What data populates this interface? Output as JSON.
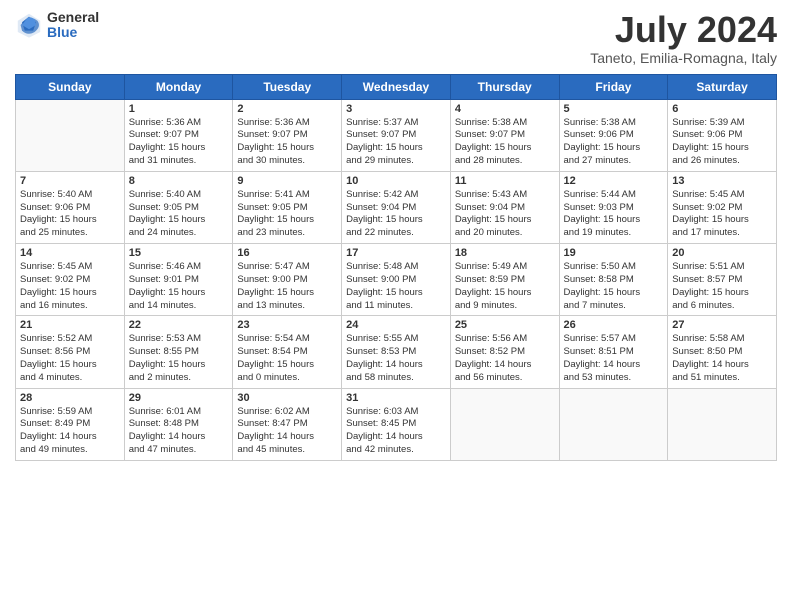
{
  "header": {
    "logo_general": "General",
    "logo_blue": "Blue",
    "title": "July 2024",
    "subtitle": "Taneto, Emilia-Romagna, Italy"
  },
  "days_of_week": [
    "Sunday",
    "Monday",
    "Tuesday",
    "Wednesday",
    "Thursday",
    "Friday",
    "Saturday"
  ],
  "weeks": [
    [
      {
        "num": "",
        "info": ""
      },
      {
        "num": "1",
        "info": "Sunrise: 5:36 AM\nSunset: 9:07 PM\nDaylight: 15 hours\nand 31 minutes."
      },
      {
        "num": "2",
        "info": "Sunrise: 5:36 AM\nSunset: 9:07 PM\nDaylight: 15 hours\nand 30 minutes."
      },
      {
        "num": "3",
        "info": "Sunrise: 5:37 AM\nSunset: 9:07 PM\nDaylight: 15 hours\nand 29 minutes."
      },
      {
        "num": "4",
        "info": "Sunrise: 5:38 AM\nSunset: 9:07 PM\nDaylight: 15 hours\nand 28 minutes."
      },
      {
        "num": "5",
        "info": "Sunrise: 5:38 AM\nSunset: 9:06 PM\nDaylight: 15 hours\nand 27 minutes."
      },
      {
        "num": "6",
        "info": "Sunrise: 5:39 AM\nSunset: 9:06 PM\nDaylight: 15 hours\nand 26 minutes."
      }
    ],
    [
      {
        "num": "7",
        "info": "Sunrise: 5:40 AM\nSunset: 9:06 PM\nDaylight: 15 hours\nand 25 minutes."
      },
      {
        "num": "8",
        "info": "Sunrise: 5:40 AM\nSunset: 9:05 PM\nDaylight: 15 hours\nand 24 minutes."
      },
      {
        "num": "9",
        "info": "Sunrise: 5:41 AM\nSunset: 9:05 PM\nDaylight: 15 hours\nand 23 minutes."
      },
      {
        "num": "10",
        "info": "Sunrise: 5:42 AM\nSunset: 9:04 PM\nDaylight: 15 hours\nand 22 minutes."
      },
      {
        "num": "11",
        "info": "Sunrise: 5:43 AM\nSunset: 9:04 PM\nDaylight: 15 hours\nand 20 minutes."
      },
      {
        "num": "12",
        "info": "Sunrise: 5:44 AM\nSunset: 9:03 PM\nDaylight: 15 hours\nand 19 minutes."
      },
      {
        "num": "13",
        "info": "Sunrise: 5:45 AM\nSunset: 9:02 PM\nDaylight: 15 hours\nand 17 minutes."
      }
    ],
    [
      {
        "num": "14",
        "info": "Sunrise: 5:45 AM\nSunset: 9:02 PM\nDaylight: 15 hours\nand 16 minutes."
      },
      {
        "num": "15",
        "info": "Sunrise: 5:46 AM\nSunset: 9:01 PM\nDaylight: 15 hours\nand 14 minutes."
      },
      {
        "num": "16",
        "info": "Sunrise: 5:47 AM\nSunset: 9:00 PM\nDaylight: 15 hours\nand 13 minutes."
      },
      {
        "num": "17",
        "info": "Sunrise: 5:48 AM\nSunset: 9:00 PM\nDaylight: 15 hours\nand 11 minutes."
      },
      {
        "num": "18",
        "info": "Sunrise: 5:49 AM\nSunset: 8:59 PM\nDaylight: 15 hours\nand 9 minutes."
      },
      {
        "num": "19",
        "info": "Sunrise: 5:50 AM\nSunset: 8:58 PM\nDaylight: 15 hours\nand 7 minutes."
      },
      {
        "num": "20",
        "info": "Sunrise: 5:51 AM\nSunset: 8:57 PM\nDaylight: 15 hours\nand 6 minutes."
      }
    ],
    [
      {
        "num": "21",
        "info": "Sunrise: 5:52 AM\nSunset: 8:56 PM\nDaylight: 15 hours\nand 4 minutes."
      },
      {
        "num": "22",
        "info": "Sunrise: 5:53 AM\nSunset: 8:55 PM\nDaylight: 15 hours\nand 2 minutes."
      },
      {
        "num": "23",
        "info": "Sunrise: 5:54 AM\nSunset: 8:54 PM\nDaylight: 15 hours\nand 0 minutes."
      },
      {
        "num": "24",
        "info": "Sunrise: 5:55 AM\nSunset: 8:53 PM\nDaylight: 14 hours\nand 58 minutes."
      },
      {
        "num": "25",
        "info": "Sunrise: 5:56 AM\nSunset: 8:52 PM\nDaylight: 14 hours\nand 56 minutes."
      },
      {
        "num": "26",
        "info": "Sunrise: 5:57 AM\nSunset: 8:51 PM\nDaylight: 14 hours\nand 53 minutes."
      },
      {
        "num": "27",
        "info": "Sunrise: 5:58 AM\nSunset: 8:50 PM\nDaylight: 14 hours\nand 51 minutes."
      }
    ],
    [
      {
        "num": "28",
        "info": "Sunrise: 5:59 AM\nSunset: 8:49 PM\nDaylight: 14 hours\nand 49 minutes."
      },
      {
        "num": "29",
        "info": "Sunrise: 6:01 AM\nSunset: 8:48 PM\nDaylight: 14 hours\nand 47 minutes."
      },
      {
        "num": "30",
        "info": "Sunrise: 6:02 AM\nSunset: 8:47 PM\nDaylight: 14 hours\nand 45 minutes."
      },
      {
        "num": "31",
        "info": "Sunrise: 6:03 AM\nSunset: 8:45 PM\nDaylight: 14 hours\nand 42 minutes."
      },
      {
        "num": "",
        "info": ""
      },
      {
        "num": "",
        "info": ""
      },
      {
        "num": "",
        "info": ""
      }
    ]
  ]
}
